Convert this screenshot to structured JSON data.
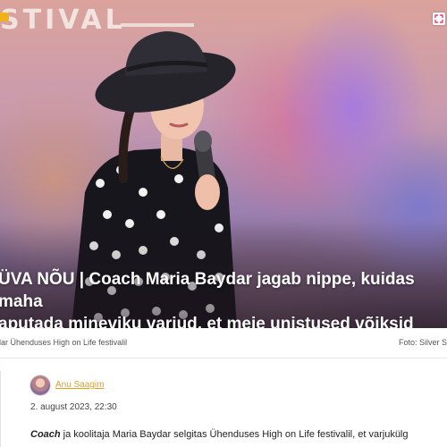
{
  "hero": {
    "sign_text": "STIVAL",
    "headline_line1": "ÜVA NÕU | Coach Maria Baydar jagab nippe, kuidas maha",
    "headline_line2": "aputada mineviku varjud, et meie unistused võiksid täituda"
  },
  "caption": {
    "text": "dar Ühenduses High on Life festivalil",
    "credit": "Foto: Silver S"
  },
  "article": {
    "author": "Anu Saagim",
    "date": "2. august 2023, 22:30",
    "lead_word": "Coach",
    "lead_rest": " ja koolitaja Maria Baydar selgitas Ühenduses High on Life festivalil, et varjukülg"
  },
  "icons": {
    "expand": "expand-icon",
    "badge": "badge-icon"
  },
  "colors": {
    "accent": "#d5a22a",
    "badge": "#f0b21b"
  }
}
